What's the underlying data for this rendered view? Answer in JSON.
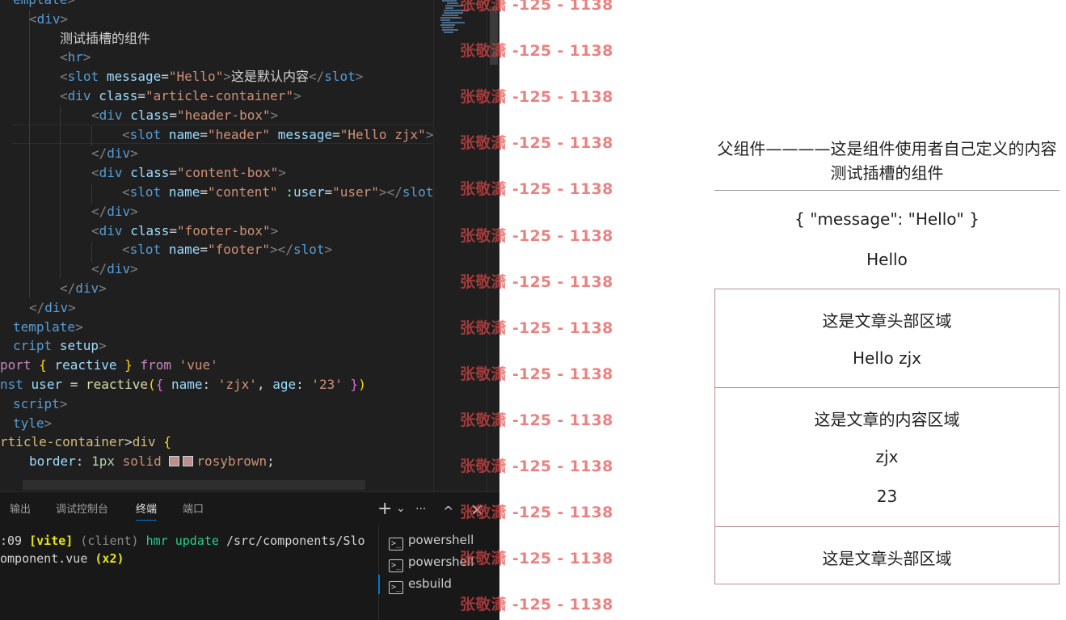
{
  "editor": {
    "lines": [
      [
        [
          "tag",
          "emplate"
        ],
        [
          "br",
          ">"
        ]
      ],
      [
        [
          "br",
          "<"
        ],
        [
          "tag",
          "div"
        ],
        [
          "br",
          ">"
        ]
      ],
      [
        [
          "cjk",
          "测试插槽的组件"
        ]
      ],
      [
        [
          "br",
          "<"
        ],
        [
          "tag",
          "hr"
        ],
        [
          "br",
          ">"
        ]
      ],
      [
        [
          "br",
          "<"
        ],
        [
          "tag",
          "slot"
        ],
        [
          "txt",
          " "
        ],
        [
          "attr",
          "message"
        ],
        [
          "txt",
          "="
        ],
        [
          "str",
          "\"Hello\""
        ],
        [
          "br",
          ">"
        ],
        [
          "cjk",
          "这是默认内容"
        ],
        [
          "br",
          "</"
        ],
        [
          "tag",
          "slot"
        ],
        [
          "br",
          ">"
        ]
      ],
      [
        [
          "br",
          "<"
        ],
        [
          "tag",
          "div"
        ],
        [
          "txt",
          " "
        ],
        [
          "attr",
          "class"
        ],
        [
          "txt",
          "="
        ],
        [
          "str",
          "\"article-container\""
        ],
        [
          "br",
          ">"
        ]
      ],
      [
        [
          "br",
          "<"
        ],
        [
          "tag",
          "div"
        ],
        [
          "txt",
          " "
        ],
        [
          "attr",
          "class"
        ],
        [
          "txt",
          "="
        ],
        [
          "str",
          "\"header-box\""
        ],
        [
          "br",
          ">"
        ]
      ],
      [
        [
          "br",
          "<"
        ],
        [
          "tag",
          "slot"
        ],
        [
          "txt",
          " "
        ],
        [
          "attr",
          "name"
        ],
        [
          "txt",
          "="
        ],
        [
          "str",
          "\"header\""
        ],
        [
          "txt",
          " "
        ],
        [
          "attr",
          "message"
        ],
        [
          "txt",
          "="
        ],
        [
          "str",
          "\"Hello zjx\""
        ],
        [
          "br",
          ">"
        ]
      ],
      [
        [
          "br",
          "</"
        ],
        [
          "tag",
          "div"
        ],
        [
          "br",
          ">"
        ]
      ],
      [
        [
          "br",
          "<"
        ],
        [
          "tag",
          "div"
        ],
        [
          "txt",
          " "
        ],
        [
          "attr",
          "class"
        ],
        [
          "txt",
          "="
        ],
        [
          "str",
          "\"content-box\""
        ],
        [
          "br",
          ">"
        ]
      ],
      [
        [
          "br",
          "<"
        ],
        [
          "tag",
          "slot"
        ],
        [
          "txt",
          " "
        ],
        [
          "attr",
          "name"
        ],
        [
          "txt",
          "="
        ],
        [
          "str",
          "\"content\""
        ],
        [
          "txt",
          " "
        ],
        [
          "attr",
          ":user"
        ],
        [
          "txt",
          "="
        ],
        [
          "str",
          "\"user\""
        ],
        [
          "br",
          "></"
        ],
        [
          "tag",
          "slot"
        ]
      ],
      [
        [
          "br",
          "</"
        ],
        [
          "tag",
          "div"
        ],
        [
          "br",
          ">"
        ]
      ],
      [
        [
          "br",
          "<"
        ],
        [
          "tag",
          "div"
        ],
        [
          "txt",
          " "
        ],
        [
          "attr",
          "class"
        ],
        [
          "txt",
          "="
        ],
        [
          "str",
          "\"footer-box\""
        ],
        [
          "br",
          ">"
        ]
      ],
      [
        [
          "br",
          "<"
        ],
        [
          "tag",
          "slot"
        ],
        [
          "txt",
          " "
        ],
        [
          "attr",
          "name"
        ],
        [
          "txt",
          "="
        ],
        [
          "str",
          "\"footer\""
        ],
        [
          "br",
          "></"
        ],
        [
          "tag",
          "slot"
        ],
        [
          "br",
          ">"
        ]
      ],
      [
        [
          "br",
          "</"
        ],
        [
          "tag",
          "div"
        ],
        [
          "br",
          ">"
        ]
      ],
      [
        [
          "br",
          "</"
        ],
        [
          "tag",
          "div"
        ],
        [
          "br",
          ">"
        ]
      ],
      [
        [
          "br",
          "</"
        ],
        [
          "tag",
          "div"
        ],
        [
          "br",
          ">"
        ]
      ],
      [
        [
          "tag",
          "template"
        ],
        [
          "br",
          ">"
        ]
      ],
      [
        [
          "tag",
          "cript"
        ],
        [
          "txt",
          " "
        ],
        [
          "attr",
          "setup"
        ],
        [
          "br",
          ">"
        ]
      ],
      [
        [
          "kw",
          "port"
        ],
        [
          "txt",
          " "
        ],
        [
          "brk",
          "{"
        ],
        [
          "txt",
          " "
        ],
        [
          "prop",
          "reactive"
        ],
        [
          "txt",
          " "
        ],
        [
          "brk",
          "}"
        ],
        [
          "txt",
          " "
        ],
        [
          "kw",
          "from"
        ],
        [
          "txt",
          " "
        ],
        [
          "str",
          "'vue'"
        ]
      ],
      [
        [
          "tag",
          "nst"
        ],
        [
          "txt",
          " "
        ],
        [
          "prop",
          "user"
        ],
        [
          "txt",
          " = "
        ],
        [
          "fn",
          "reactive"
        ],
        [
          "brk",
          "("
        ],
        [
          "brk2",
          "{"
        ],
        [
          "txt",
          " "
        ],
        [
          "prop",
          "name"
        ],
        [
          "txt",
          ": "
        ],
        [
          "str",
          "'zjx'"
        ],
        [
          "txt",
          ", "
        ],
        [
          "prop",
          "age"
        ],
        [
          "txt",
          ": "
        ],
        [
          "str",
          "'23'"
        ],
        [
          "txt",
          " "
        ],
        [
          "brk2",
          "}"
        ],
        [
          "brk",
          ")"
        ]
      ],
      [
        [
          "tag",
          "script"
        ],
        [
          "br",
          ">"
        ]
      ],
      [
        [
          "tag",
          "tyle"
        ],
        [
          "br",
          ">"
        ]
      ],
      [
        [
          "sel",
          "rticle-container"
        ],
        [
          "txt",
          ">"
        ],
        [
          "sel",
          "div"
        ],
        [
          "txt",
          " "
        ],
        [
          "brk",
          "{"
        ]
      ],
      [
        [
          "prop",
          "border"
        ],
        [
          "txt",
          ": "
        ],
        [
          "num",
          "1px"
        ],
        [
          "txt",
          " "
        ],
        [
          "str",
          "solid"
        ],
        [
          "txt",
          " "
        ],
        [
          "swatch",
          ""
        ],
        [
          "swatch",
          ""
        ],
        [
          "str",
          "rosybrown"
        ],
        [
          "txt",
          ";"
        ]
      ]
    ]
  },
  "panel": {
    "tabs": [
      "输出",
      "调试控制台",
      "终端",
      "端口"
    ],
    "active_tab": "终端",
    "actions": {
      "add": "+",
      "dropdown": "⌄",
      "more": "···",
      "maximize": "^",
      "close": "×"
    },
    "terminal_lines": [
      [
        [
          "t-c",
          ":09 "
        ],
        [
          "t-y",
          "[vite]"
        ],
        [
          "t-dim",
          " (client) "
        ],
        [
          "t-g",
          "hmr update"
        ],
        [
          "t-c",
          " /src/components/Slo"
        ]
      ],
      [
        [
          "t-c",
          "omponent.vue "
        ],
        [
          "t-y",
          "(x2)"
        ]
      ]
    ],
    "terminals": [
      {
        "icon": ">_",
        "label": "powershell"
      },
      {
        "icon": ">_",
        "label": "powershell"
      },
      {
        "icon": ">_",
        "label": "esbuild"
      }
    ]
  },
  "watermark": {
    "text": "张敬潇 -125 - 1138",
    "count": 14
  },
  "preview": {
    "parent_line": "父组件————这是组件使用者自己定义的内容",
    "component_title": "测试插槽的组件",
    "slot_props": "{ \"message\": \"Hello\" }",
    "slot_message": "Hello",
    "header_box": {
      "title": "这是文章头部区域",
      "message": "Hello zjx"
    },
    "content_box": {
      "title": "这是文章的内容区域",
      "name": "zjx",
      "age": "23"
    },
    "footer_box": {
      "title": "这是文章头部区域"
    }
  },
  "colors": {
    "border_rosybrown": "#bc8f8f",
    "watermark": "#e24747",
    "accent": "#0078d4"
  }
}
